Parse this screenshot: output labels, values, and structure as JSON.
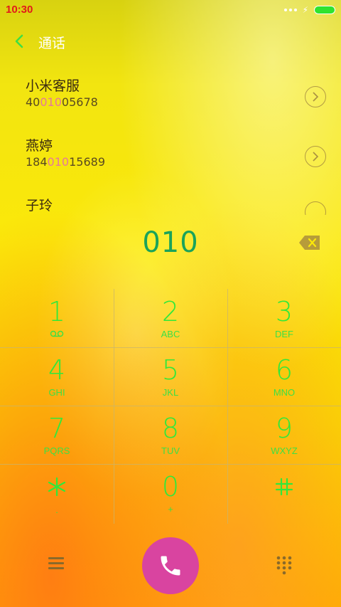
{
  "status_bar": {
    "time": "10:30"
  },
  "header": {
    "title": "通话"
  },
  "contacts": [
    {
      "name": "小米客服",
      "number_pre": "40",
      "number_match": "010",
      "number_post": "05678"
    },
    {
      "name": "燕婷",
      "number_pre": "184",
      "number_match": "010",
      "number_post": "15689"
    },
    {
      "name": "子玲",
      "number_pre": "",
      "number_match": "",
      "number_post": ""
    }
  ],
  "dial": {
    "entered": "010"
  },
  "keypad": [
    {
      "digit": "1",
      "letters": "",
      "icon": "voicemail-icon"
    },
    {
      "digit": "2",
      "letters": "ABC"
    },
    {
      "digit": "3",
      "letters": "DEF"
    },
    {
      "digit": "4",
      "letters": "GHI"
    },
    {
      "digit": "5",
      "letters": "JKL"
    },
    {
      "digit": "6",
      "letters": "MNO"
    },
    {
      "digit": "7",
      "letters": "PQRS"
    },
    {
      "digit": "8",
      "letters": "TUV"
    },
    {
      "digit": "9",
      "letters": "WXYZ"
    },
    {
      "digit": "*",
      "letters": ""
    },
    {
      "digit": "0",
      "letters": "+"
    },
    {
      "digit": "#",
      "letters": ""
    }
  ],
  "colors": {
    "accent_green": "#31e83a",
    "digits_green": "#1aa35a",
    "call_button": "#d944a0",
    "match_highlight": "#e6789a"
  }
}
